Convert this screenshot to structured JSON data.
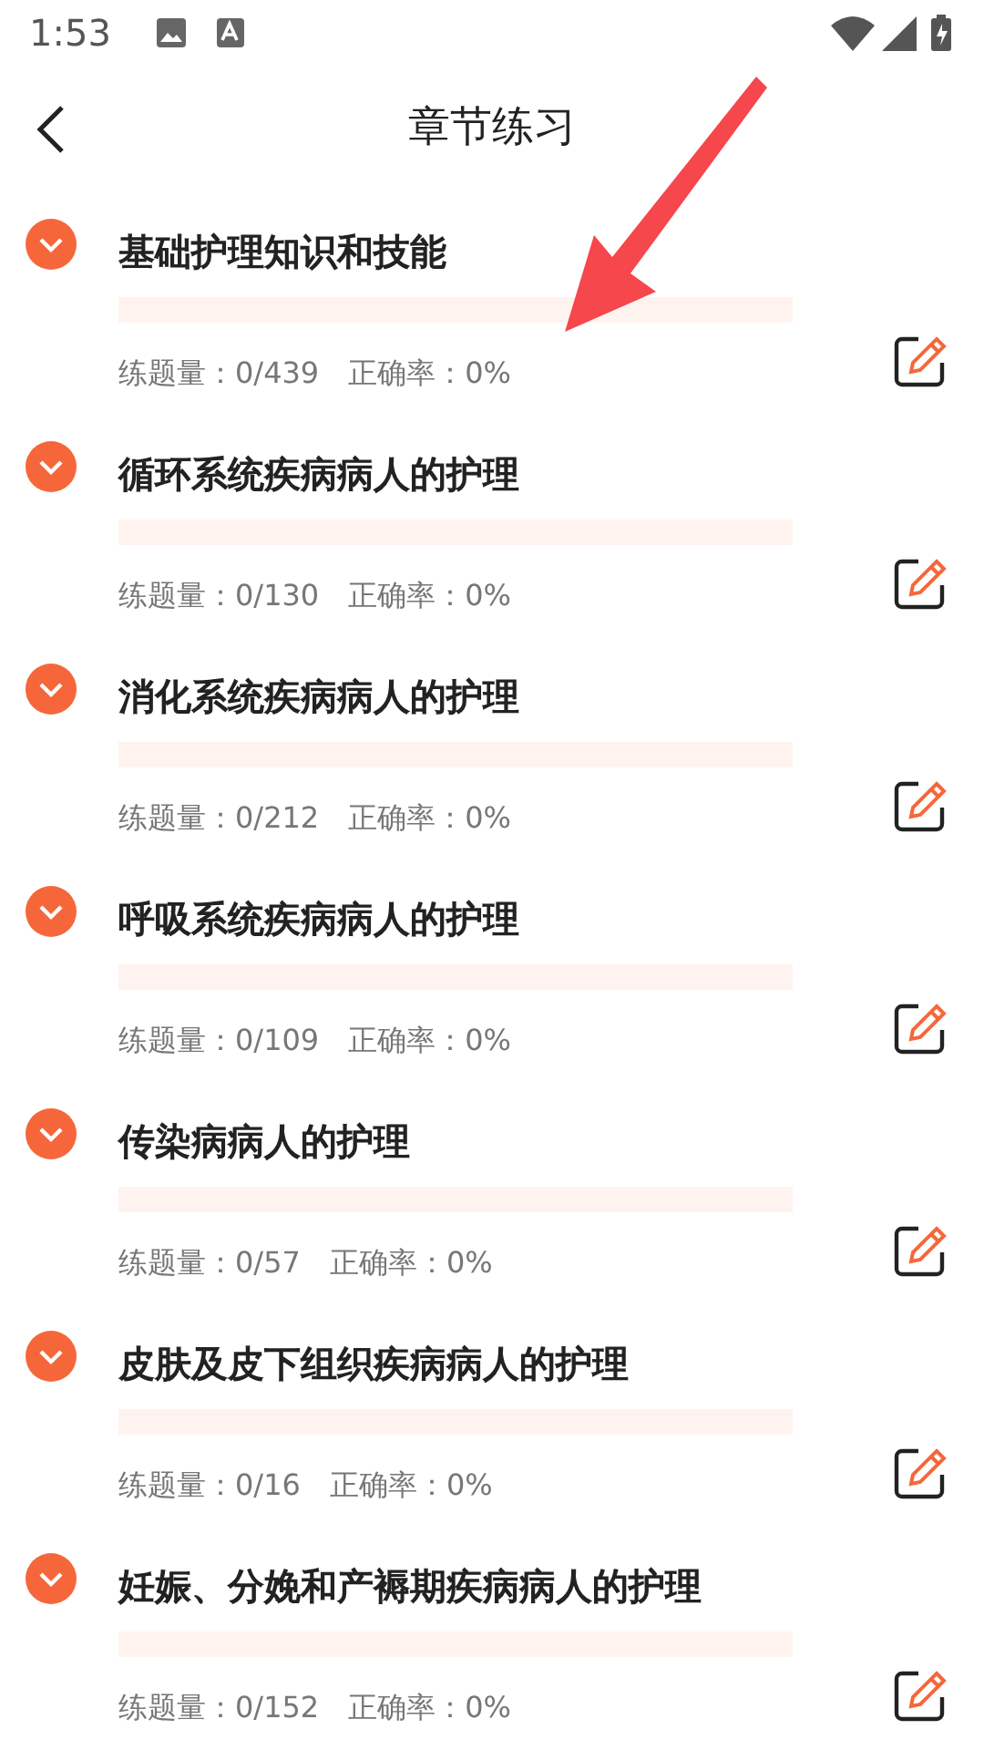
{
  "status_bar": {
    "time": "1:53"
  },
  "header": {
    "title": "章节练习"
  },
  "chapters": [
    {
      "title": "基础护理知识和技能",
      "level": 0,
      "count": "练题量：0/439",
      "accuracy": "正确率：0%"
    },
    {
      "title": "循环系统疾病病人的护理",
      "level": 0,
      "count": "练题量：0/130",
      "accuracy": "正确率：0%"
    },
    {
      "title": "消化系统疾病病人的护理",
      "level": 0,
      "count": "练题量：0/212",
      "accuracy": "正确率：0%"
    },
    {
      "title": "呼吸系统疾病病人的护理",
      "level": 0,
      "count": "练题量：0/109",
      "accuracy": "正确率：0%"
    },
    {
      "title": "传染病病人的护理",
      "level": 0,
      "count": "练题量：0/57",
      "accuracy": "正确率：0%"
    },
    {
      "title": "皮肤及皮下组织疾病病人的护理",
      "level": 0,
      "count": "练题量：0/16",
      "accuracy": "正确率：0%"
    },
    {
      "title": "妊娠、分娩和产褥期疾病病人的护理",
      "level": 0,
      "count": "练题量：0/152",
      "accuracy": "正确率：0%"
    }
  ]
}
